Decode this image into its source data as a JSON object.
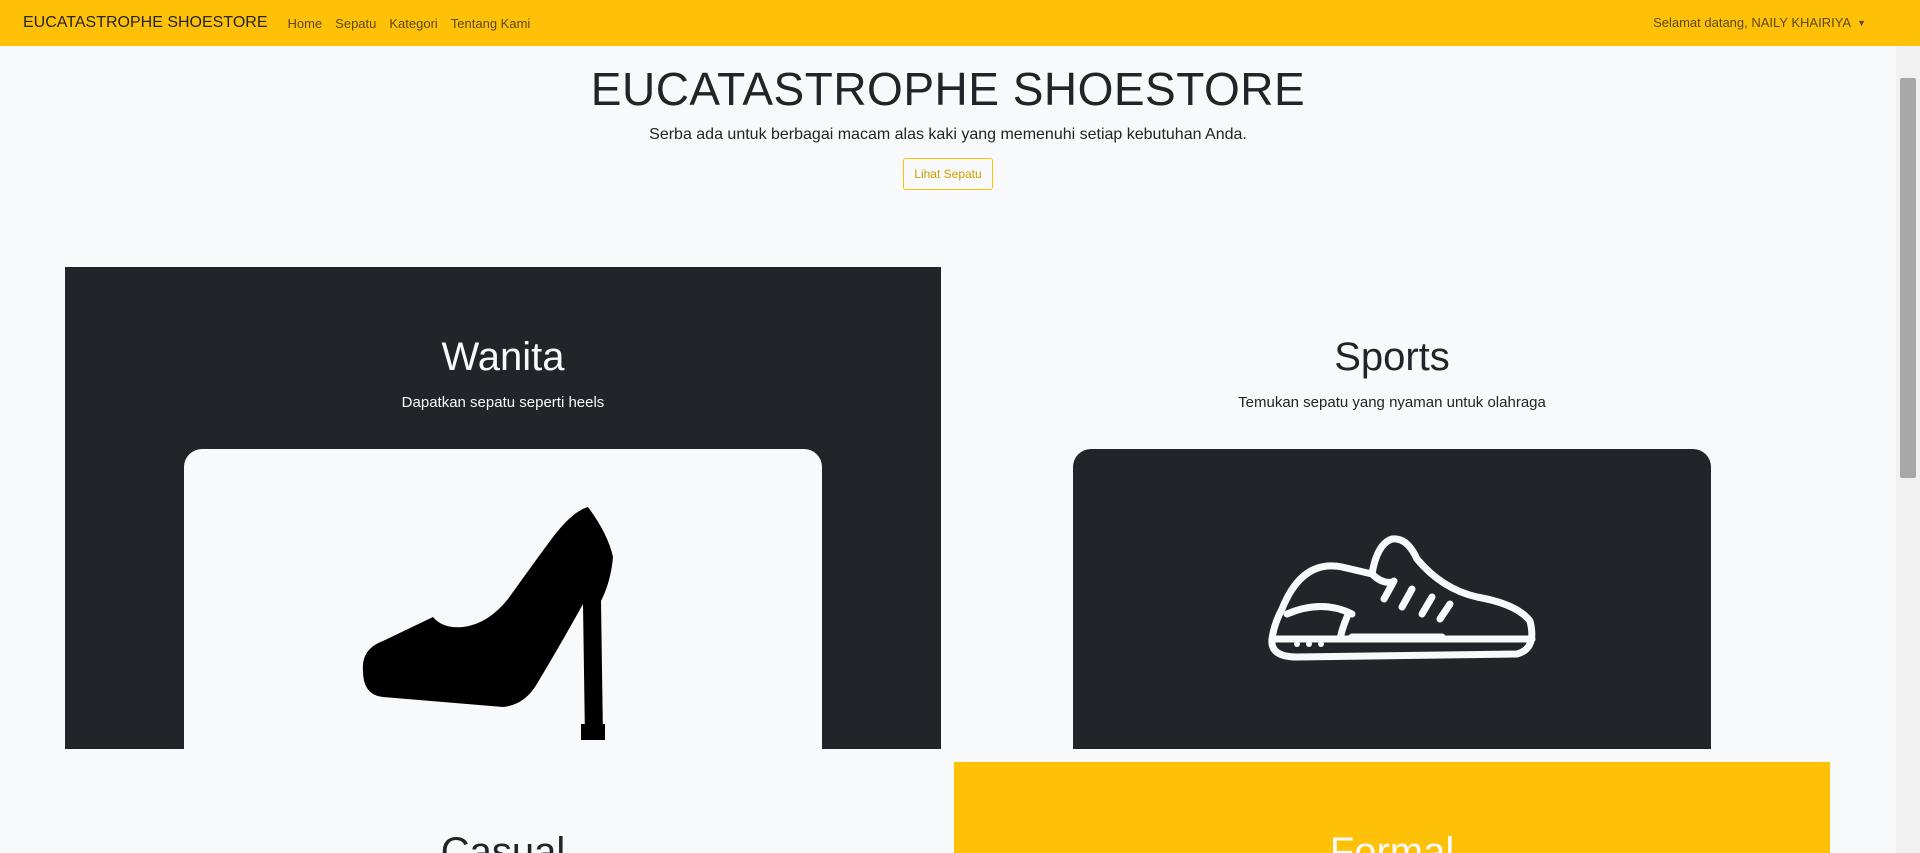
{
  "navbar": {
    "brand": "EUCATASTROPHE SHOESTORE",
    "links": [
      "Home",
      "Sepatu",
      "Kategori",
      "Tentang Kami"
    ],
    "user_menu": "Selamat datang, NAILY KHAIRIYA"
  },
  "hero": {
    "title": "EUCATASTROPHE SHOESTORE",
    "subtitle": "Serba ada untuk berbagai macam alas kaki yang memenuhi setiap kebutuhan Anda.",
    "button": "Lihat Sepatu"
  },
  "categories": [
    {
      "title": "Wanita",
      "subtitle": "Dapatkan sepatu seperti heels",
      "icon": "high-heel-icon"
    },
    {
      "title": "Sports",
      "subtitle": "Temukan sepatu yang nyaman untuk olahraga",
      "icon": "sneaker-icon"
    },
    {
      "title": "Casual",
      "subtitle": ""
    },
    {
      "title": "Formal",
      "subtitle": ""
    }
  ],
  "colors": {
    "accent": "#ffc107",
    "dark": "#212529",
    "light": "#f8f9fa"
  }
}
